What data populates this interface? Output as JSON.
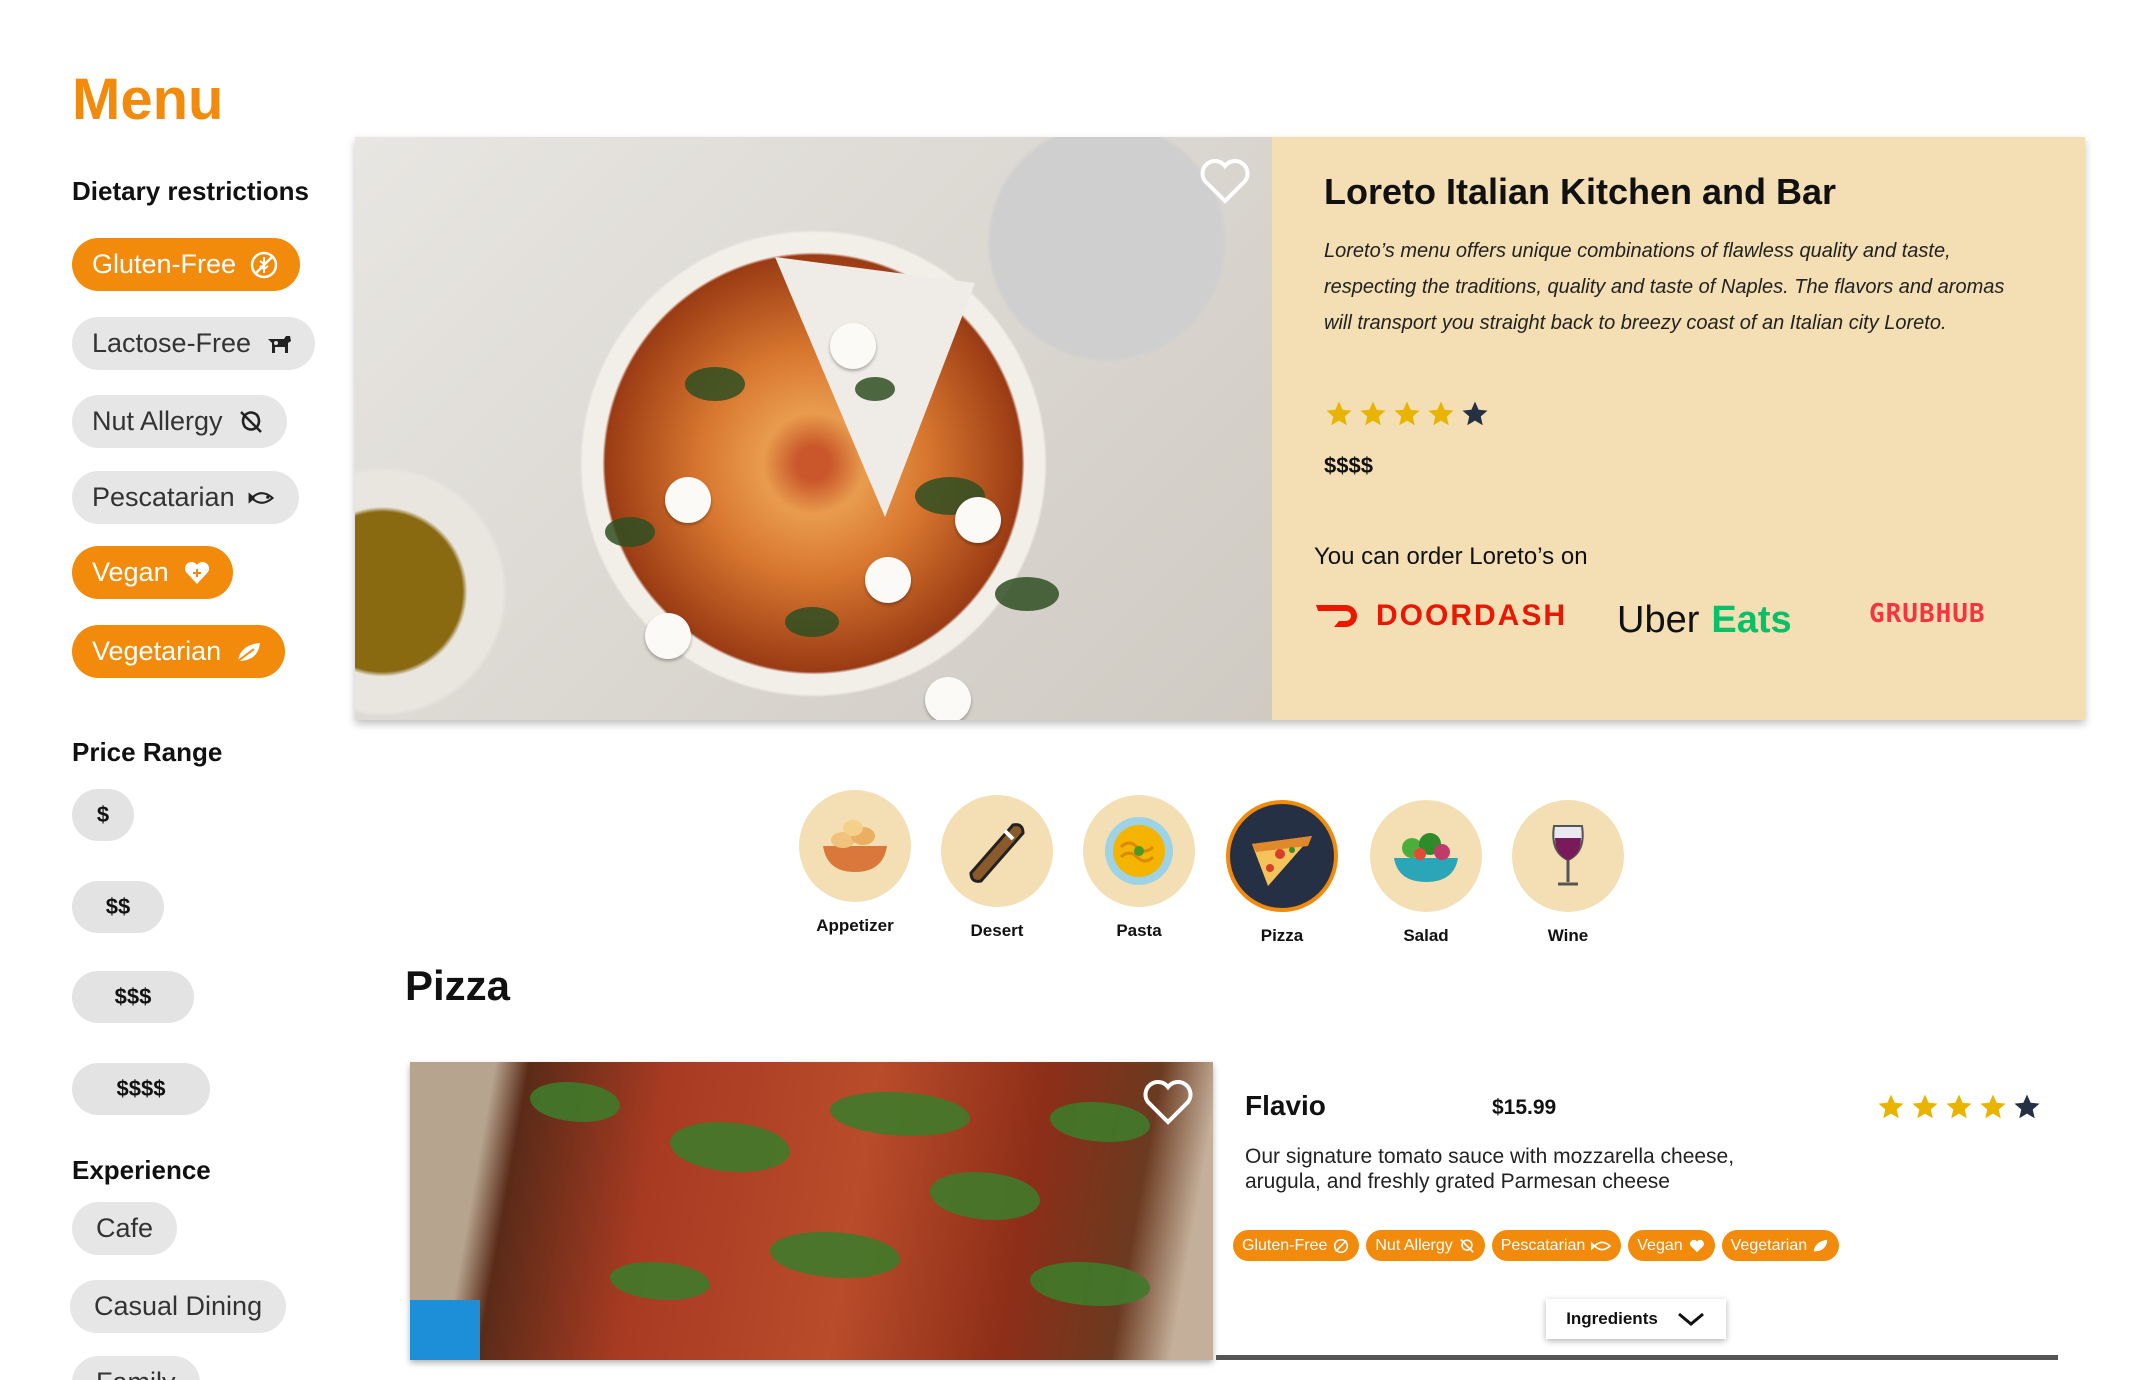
{
  "sidebar": {
    "title": "Menu",
    "dietary_title": "Dietary restrictions",
    "dietary": [
      {
        "label": "Gluten-Free",
        "icon": "wheat-off-icon",
        "active": true
      },
      {
        "label": "Lactose-Free",
        "icon": "cow-icon",
        "active": false
      },
      {
        "label": "Nut Allergy",
        "icon": "nut-off-icon",
        "active": false
      },
      {
        "label": "Pescatarian",
        "icon": "fish-icon",
        "active": false
      },
      {
        "label": "Vegan",
        "icon": "heart-icon",
        "active": true
      },
      {
        "label": "Vegetarian",
        "icon": "leaf-icon",
        "active": true
      }
    ],
    "price_title": "Price Range",
    "prices": [
      "$",
      "$$",
      "$$$",
      "$$$$"
    ],
    "experience_title": "Experience",
    "experience": [
      "Cafe",
      "Casual Dining",
      "Family"
    ]
  },
  "hero": {
    "name": "Loreto Italian Kitchen and Bar",
    "description": "Loreto’s menu offers unique combinations of flawless quality and taste, respecting the traditions, quality and taste of Naples. The flavors and aromas will transport you straight back to breezy coast of an Italian city Loreto.",
    "rating": 4,
    "rating_max": 5,
    "price": "$$$$",
    "order_label": "You can order Loreto’s on",
    "delivery": {
      "doordash": "DOORDASH",
      "uber": "Uber",
      "eats": "Eats",
      "grubhub": "GRUBHUB"
    }
  },
  "categories": [
    {
      "label": "Appetizer",
      "icon": "bread-bowl-icon",
      "active": false
    },
    {
      "label": "Desert",
      "icon": "cannoli-icon",
      "active": false
    },
    {
      "label": "Pasta",
      "icon": "pasta-icon",
      "active": false
    },
    {
      "label": "Pizza",
      "icon": "pizza-slice-icon",
      "active": true
    },
    {
      "label": "Salad",
      "icon": "salad-bowl-icon",
      "active": false
    },
    {
      "label": "Wine",
      "icon": "wine-glass-icon",
      "active": false
    }
  ],
  "section_heading": "Pizza",
  "item": {
    "name": "Flavio",
    "price": "$15.99",
    "description": "Our signature tomato sauce with mozzarella cheese, arugula, and freshly grated Parmesan cheese",
    "rating": 4,
    "rating_max": 5,
    "tags": [
      "Gluten-Free",
      "Nut Allergy",
      "Pescatarian",
      "Vegan",
      "Vegetarian"
    ],
    "ingredients_label": "Ingredients"
  },
  "colors": {
    "accent": "#f28a0b",
    "hero_bg": "#f3dfb3",
    "star": "#e9b400",
    "star_empty": "#263044",
    "chip_bg": "#e6e6e6"
  }
}
